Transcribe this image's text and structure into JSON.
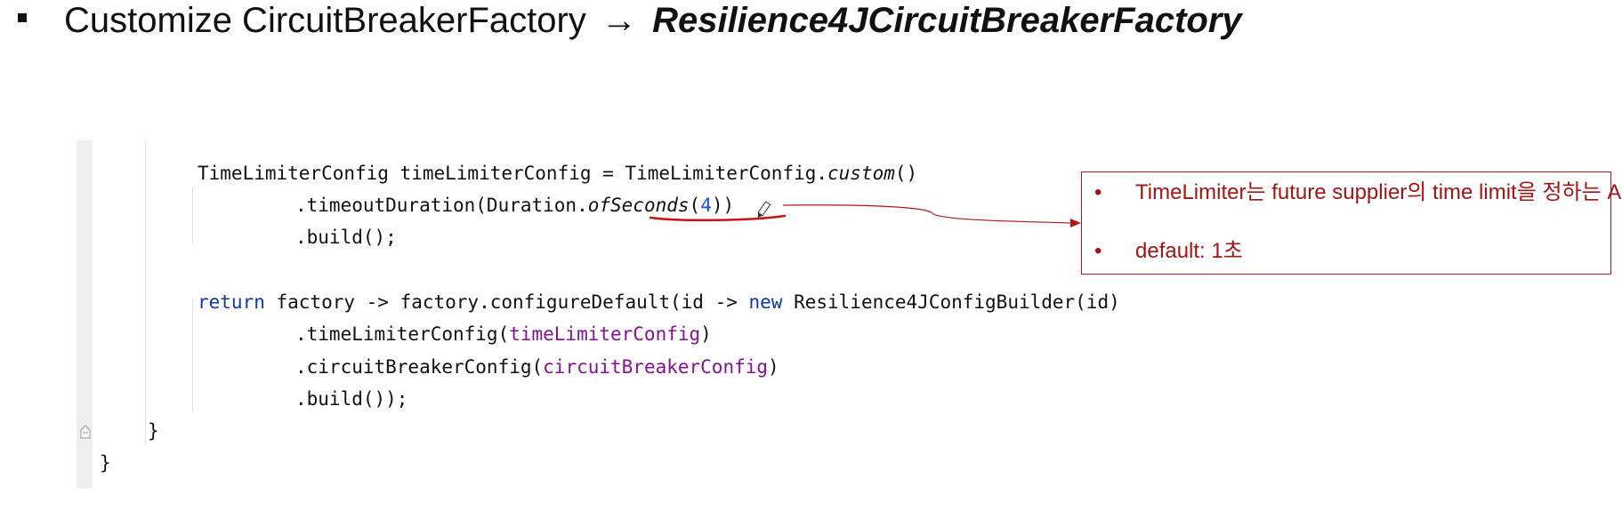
{
  "slide": {
    "title_prefix": "Customize CircuitBreakerFactory",
    "title_arrow": "→",
    "title_emphasis": "Resilience4JCircuitBreakerFactory"
  },
  "code": {
    "line1": {
      "a": "TimeLimiterConfig timeLimiterConfig = TimeLimiterConfig.",
      "b": "custom",
      "c": "()"
    },
    "line2": {
      "a": ".timeoutDuration(Duration.",
      "b": "ofSeconds",
      "c": "(",
      "d": "4",
      "e": "))"
    },
    "line3": {
      "a": ".build();"
    },
    "line5": {
      "kw1": "return",
      "a": " factory -> factory.configureDefault(id -> ",
      "kw2": "new",
      "b": " Resilience4JConfigBuilder(id)"
    },
    "line6": {
      "a": ".timeLimiterConfig(",
      "f": "timeLimiterConfig",
      "b": ")"
    },
    "line7": {
      "a": ".circuitBreakerConfig(",
      "f": "circuitBreakerConfig",
      "b": ")"
    },
    "line8": {
      "a": ".build());"
    },
    "line9": {
      "a": "}"
    },
    "line10": {
      "a": "}"
    }
  },
  "annotation": {
    "items": [
      "TimeLimiter는 future supplier의 time limit을 정하는 API",
      "default: 1초"
    ],
    "color": "#a31515"
  },
  "icons": {
    "bullet": "square-bullet-icon",
    "fold": "fold-marker-icon",
    "pen": "pen-cursor-icon"
  }
}
